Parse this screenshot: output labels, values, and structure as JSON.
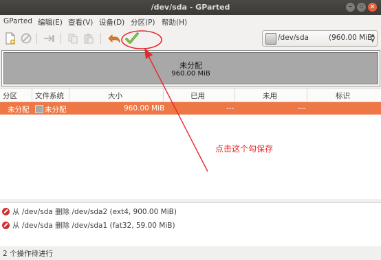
{
  "window": {
    "title": "/dev/sda - GParted"
  },
  "menu": [
    "GParted",
    "编辑(E)",
    "查看(V)",
    "设备(D)",
    "分区(P)",
    "帮助(H)"
  ],
  "toolbar": {
    "icons": [
      "new-partition-icon",
      "delete-icon",
      "resize-move-icon",
      "copy-icon",
      "paste-icon",
      "undo-icon",
      "apply-icon"
    ]
  },
  "device": {
    "name": "/dev/sda",
    "size": "(960.00 MiB)"
  },
  "visual": {
    "label": "未分配",
    "size": "960.00 MiB"
  },
  "table": {
    "headers": [
      "分区",
      "文件系统",
      "大小",
      "已用",
      "未用",
      "标识"
    ],
    "rows": [
      {
        "partition": "未分配",
        "filesystem": "未分配",
        "size": "960.00 MiB",
        "used": "---",
        "unused": "---",
        "flags": ""
      }
    ]
  },
  "operations": [
    "从 /dev/sda 删除 /dev/sda2 (ext4, 900.00 MiB)",
    "从 /dev/sda 删除 /dev/sda1 (fat32, 59.00 MiB)"
  ],
  "status": "2 个操作待进行",
  "annotation": {
    "text": "点击这个勾保存",
    "color": "#e8262b"
  },
  "colors": {
    "selected_row": "#ee7746",
    "unallocated": "#a8a8a8",
    "titlebar": "#3b3a37"
  }
}
